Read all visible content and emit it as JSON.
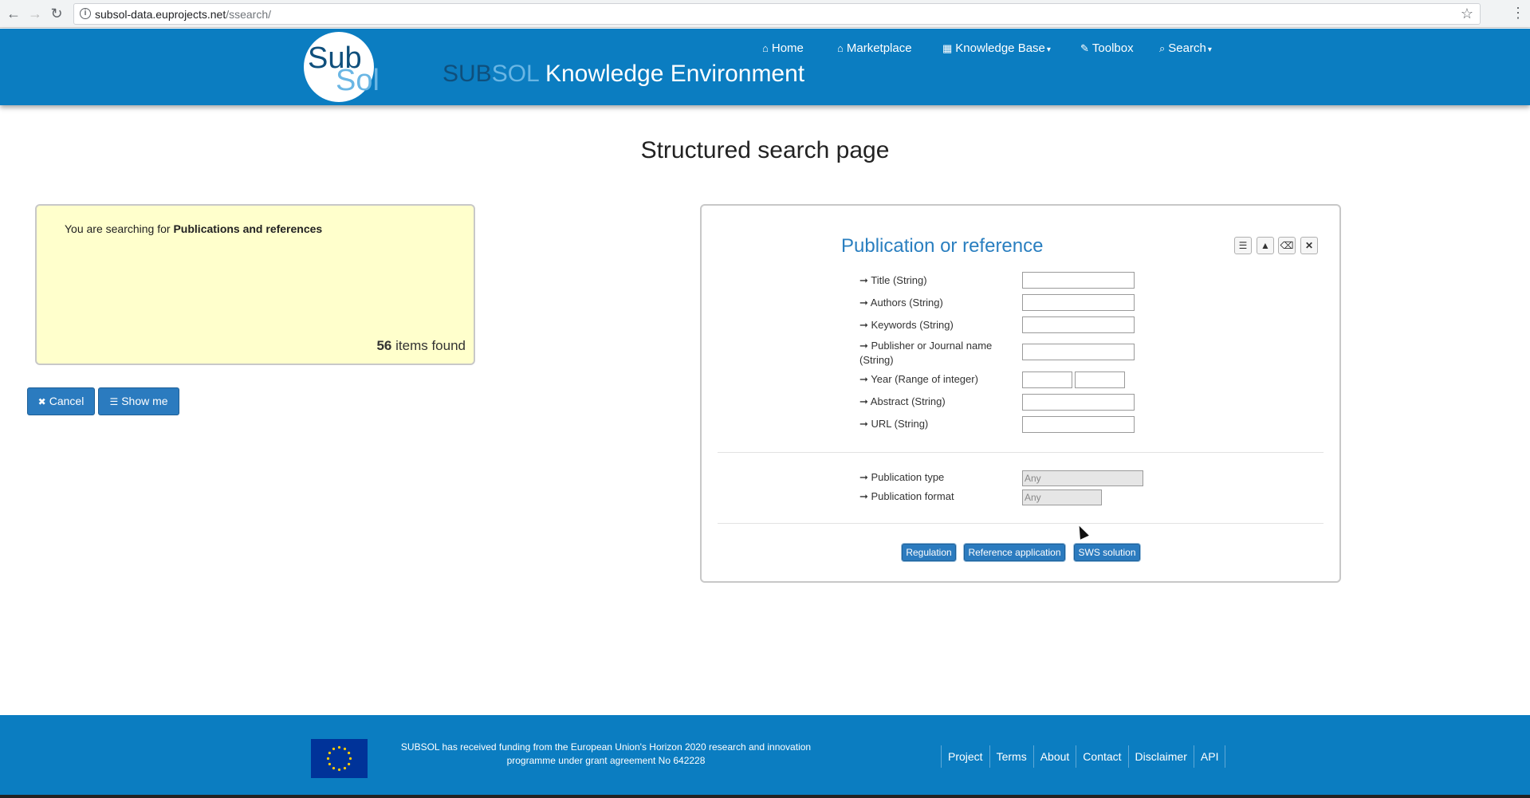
{
  "browser": {
    "url_host": "subsol-data.euprojects.net",
    "url_path": "/ssearch/"
  },
  "header": {
    "logo_sub": "Sub",
    "logo_sol": "Sol",
    "title_part1": "SUB",
    "title_part2": "SOL",
    "title_rest": " Knowledge Environment",
    "nav": [
      {
        "label": "Home"
      },
      {
        "label": "Marketplace"
      },
      {
        "label": "Knowledge Base"
      },
      {
        "label": "Toolbox"
      },
      {
        "label": "Search"
      }
    ]
  },
  "page": {
    "title": "Structured search page"
  },
  "summary": {
    "prefix": "You are searching for ",
    "subject": "Publications and references",
    "count": "56",
    "count_suffix": " items found"
  },
  "actions": {
    "cancel": "Cancel",
    "show_me": "Show me"
  },
  "form": {
    "title": "Publication or reference",
    "fields": [
      {
        "label": "➞ Title (String)"
      },
      {
        "label": "➞ Authors (String)"
      },
      {
        "label": "➞ Keywords (String)"
      },
      {
        "label": "➞ Publisher or Journal name"
      },
      {
        "label": "(String)"
      },
      {
        "label": "➞ Year (Range of integer)"
      },
      {
        "label": "➞ Abstract (String)"
      },
      {
        "label": "➞ URL (String)"
      }
    ],
    "selects": [
      {
        "label": "➞ Publication type",
        "value": "Any"
      },
      {
        "label": "➞ Publication format",
        "value": "Any"
      }
    ],
    "related": [
      {
        "label": "Regulation"
      },
      {
        "label": "Reference application"
      },
      {
        "label": "SWS solution"
      }
    ]
  },
  "footer": {
    "funding_line1": "SUBSOL has received funding from the European Union's Horizon 2020 research and innovation",
    "funding_line2": "programme under grant agreement No 642228",
    "links": [
      {
        "label": "Project"
      },
      {
        "label": "Terms"
      },
      {
        "label": "About"
      },
      {
        "label": "Contact"
      },
      {
        "label": "Disclaimer"
      },
      {
        "label": "API"
      }
    ]
  }
}
